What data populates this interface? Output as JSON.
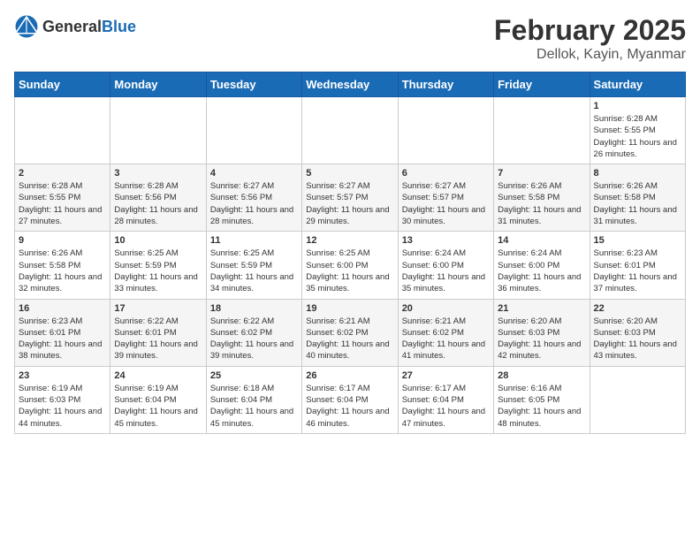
{
  "header": {
    "logo_general": "General",
    "logo_blue": "Blue",
    "main_title": "February 2025",
    "sub_title": "Dellok, Kayin, Myanmar"
  },
  "weekdays": [
    "Sunday",
    "Monday",
    "Tuesday",
    "Wednesday",
    "Thursday",
    "Friday",
    "Saturday"
  ],
  "weeks": [
    [
      {
        "day": "",
        "info": ""
      },
      {
        "day": "",
        "info": ""
      },
      {
        "day": "",
        "info": ""
      },
      {
        "day": "",
        "info": ""
      },
      {
        "day": "",
        "info": ""
      },
      {
        "day": "",
        "info": ""
      },
      {
        "day": "1",
        "info": "Sunrise: 6:28 AM\nSunset: 5:55 PM\nDaylight: 11 hours and 26 minutes."
      }
    ],
    [
      {
        "day": "2",
        "info": "Sunrise: 6:28 AM\nSunset: 5:55 PM\nDaylight: 11 hours and 27 minutes."
      },
      {
        "day": "3",
        "info": "Sunrise: 6:28 AM\nSunset: 5:56 PM\nDaylight: 11 hours and 28 minutes."
      },
      {
        "day": "4",
        "info": "Sunrise: 6:27 AM\nSunset: 5:56 PM\nDaylight: 11 hours and 28 minutes."
      },
      {
        "day": "5",
        "info": "Sunrise: 6:27 AM\nSunset: 5:57 PM\nDaylight: 11 hours and 29 minutes."
      },
      {
        "day": "6",
        "info": "Sunrise: 6:27 AM\nSunset: 5:57 PM\nDaylight: 11 hours and 30 minutes."
      },
      {
        "day": "7",
        "info": "Sunrise: 6:26 AM\nSunset: 5:58 PM\nDaylight: 11 hours and 31 minutes."
      },
      {
        "day": "8",
        "info": "Sunrise: 6:26 AM\nSunset: 5:58 PM\nDaylight: 11 hours and 31 minutes."
      }
    ],
    [
      {
        "day": "9",
        "info": "Sunrise: 6:26 AM\nSunset: 5:58 PM\nDaylight: 11 hours and 32 minutes."
      },
      {
        "day": "10",
        "info": "Sunrise: 6:25 AM\nSunset: 5:59 PM\nDaylight: 11 hours and 33 minutes."
      },
      {
        "day": "11",
        "info": "Sunrise: 6:25 AM\nSunset: 5:59 PM\nDaylight: 11 hours and 34 minutes."
      },
      {
        "day": "12",
        "info": "Sunrise: 6:25 AM\nSunset: 6:00 PM\nDaylight: 11 hours and 35 minutes."
      },
      {
        "day": "13",
        "info": "Sunrise: 6:24 AM\nSunset: 6:00 PM\nDaylight: 11 hours and 35 minutes."
      },
      {
        "day": "14",
        "info": "Sunrise: 6:24 AM\nSunset: 6:00 PM\nDaylight: 11 hours and 36 minutes."
      },
      {
        "day": "15",
        "info": "Sunrise: 6:23 AM\nSunset: 6:01 PM\nDaylight: 11 hours and 37 minutes."
      }
    ],
    [
      {
        "day": "16",
        "info": "Sunrise: 6:23 AM\nSunset: 6:01 PM\nDaylight: 11 hours and 38 minutes."
      },
      {
        "day": "17",
        "info": "Sunrise: 6:22 AM\nSunset: 6:01 PM\nDaylight: 11 hours and 39 minutes."
      },
      {
        "day": "18",
        "info": "Sunrise: 6:22 AM\nSunset: 6:02 PM\nDaylight: 11 hours and 39 minutes."
      },
      {
        "day": "19",
        "info": "Sunrise: 6:21 AM\nSunset: 6:02 PM\nDaylight: 11 hours and 40 minutes."
      },
      {
        "day": "20",
        "info": "Sunrise: 6:21 AM\nSunset: 6:02 PM\nDaylight: 11 hours and 41 minutes."
      },
      {
        "day": "21",
        "info": "Sunrise: 6:20 AM\nSunset: 6:03 PM\nDaylight: 11 hours and 42 minutes."
      },
      {
        "day": "22",
        "info": "Sunrise: 6:20 AM\nSunset: 6:03 PM\nDaylight: 11 hours and 43 minutes."
      }
    ],
    [
      {
        "day": "23",
        "info": "Sunrise: 6:19 AM\nSunset: 6:03 PM\nDaylight: 11 hours and 44 minutes."
      },
      {
        "day": "24",
        "info": "Sunrise: 6:19 AM\nSunset: 6:04 PM\nDaylight: 11 hours and 45 minutes."
      },
      {
        "day": "25",
        "info": "Sunrise: 6:18 AM\nSunset: 6:04 PM\nDaylight: 11 hours and 45 minutes."
      },
      {
        "day": "26",
        "info": "Sunrise: 6:17 AM\nSunset: 6:04 PM\nDaylight: 11 hours and 46 minutes."
      },
      {
        "day": "27",
        "info": "Sunrise: 6:17 AM\nSunset: 6:04 PM\nDaylight: 11 hours and 47 minutes."
      },
      {
        "day": "28",
        "info": "Sunrise: 6:16 AM\nSunset: 6:05 PM\nDaylight: 11 hours and 48 minutes."
      },
      {
        "day": "",
        "info": ""
      }
    ]
  ]
}
